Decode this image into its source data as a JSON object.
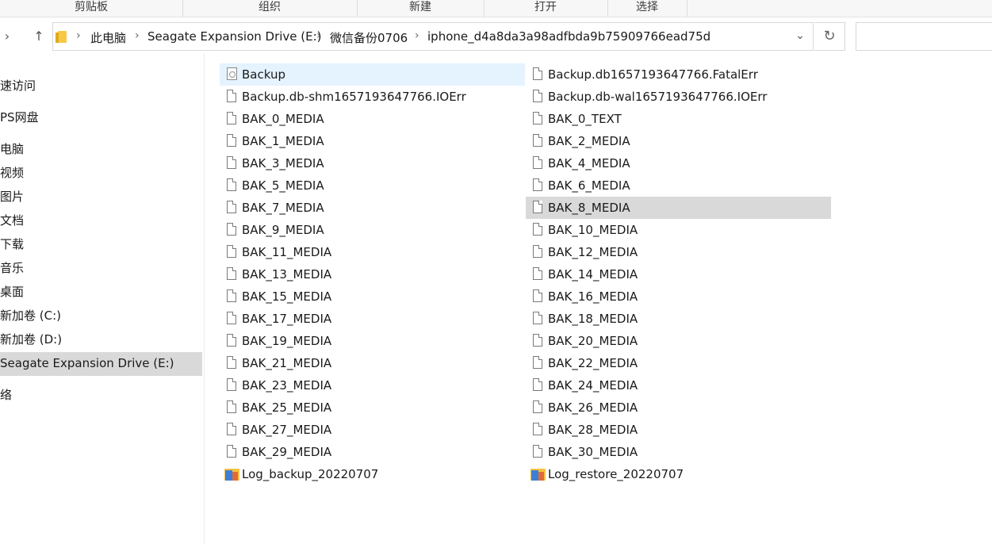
{
  "ribbon": {
    "groups": [
      "剪贴板",
      "组织",
      "新建",
      "打开",
      "选择"
    ]
  },
  "navbar": {
    "back_icon": "chevron-right-icon",
    "up_icon": "arrow-up-icon",
    "breadcrumbs": [
      "此电脑",
      "Seagate Expansion Drive (E:)",
      "微信备份0706",
      "iphone_d4a8da3a98adfbda9b75909766ead75d"
    ],
    "refresh_icon": "refresh-icon",
    "search_placeholder": ""
  },
  "sidebar": {
    "items": [
      "速访问",
      "PS网盘",
      "电脑",
      "视频",
      "图片",
      "文档",
      "下载",
      "音乐",
      "桌面",
      "新加卷 (C:)",
      "新加卷 (D:)",
      "Seagate Expansion Drive (E:)",
      "络"
    ],
    "selected_index": 11
  },
  "files": {
    "left": [
      {
        "name": "Backup",
        "icon": "database-file-icon"
      },
      {
        "name": "Backup.db-shm1657193647766.IOErr",
        "icon": "file-icon"
      },
      {
        "name": "BAK_0_MEDIA",
        "icon": "file-icon"
      },
      {
        "name": "BAK_1_MEDIA",
        "icon": "file-icon"
      },
      {
        "name": "BAK_3_MEDIA",
        "icon": "file-icon"
      },
      {
        "name": "BAK_5_MEDIA",
        "icon": "file-icon"
      },
      {
        "name": "BAK_7_MEDIA",
        "icon": "file-icon"
      },
      {
        "name": "BAK_9_MEDIA",
        "icon": "file-icon"
      },
      {
        "name": "BAK_11_MEDIA",
        "icon": "file-icon"
      },
      {
        "name": "BAK_13_MEDIA",
        "icon": "file-icon"
      },
      {
        "name": "BAK_15_MEDIA",
        "icon": "file-icon"
      },
      {
        "name": "BAK_17_MEDIA",
        "icon": "file-icon"
      },
      {
        "name": "BAK_19_MEDIA",
        "icon": "file-icon"
      },
      {
        "name": "BAK_21_MEDIA",
        "icon": "file-icon"
      },
      {
        "name": "BAK_23_MEDIA",
        "icon": "file-icon"
      },
      {
        "name": "BAK_25_MEDIA",
        "icon": "file-icon"
      },
      {
        "name": "BAK_27_MEDIA",
        "icon": "file-icon"
      },
      {
        "name": "BAK_29_MEDIA",
        "icon": "file-icon"
      },
      {
        "name": "Log_backup_20220707",
        "icon": "archive-folder-icon"
      }
    ],
    "right": [
      {
        "name": "Backup.db1657193647766.FatalErr",
        "icon": "file-icon"
      },
      {
        "name": "Backup.db-wal1657193647766.IOErr",
        "icon": "file-icon"
      },
      {
        "name": "BAK_0_TEXT",
        "icon": "file-icon"
      },
      {
        "name": "BAK_2_MEDIA",
        "icon": "file-icon"
      },
      {
        "name": "BAK_4_MEDIA",
        "icon": "file-icon"
      },
      {
        "name": "BAK_6_MEDIA",
        "icon": "file-icon"
      },
      {
        "name": "BAK_8_MEDIA",
        "icon": "file-icon"
      },
      {
        "name": "BAK_10_MEDIA",
        "icon": "file-icon"
      },
      {
        "name": "BAK_12_MEDIA",
        "icon": "file-icon"
      },
      {
        "name": "BAK_14_MEDIA",
        "icon": "file-icon"
      },
      {
        "name": "BAK_16_MEDIA",
        "icon": "file-icon"
      },
      {
        "name": "BAK_18_MEDIA",
        "icon": "file-icon"
      },
      {
        "name": "BAK_20_MEDIA",
        "icon": "file-icon"
      },
      {
        "name": "BAK_22_MEDIA",
        "icon": "file-icon"
      },
      {
        "name": "BAK_24_MEDIA",
        "icon": "file-icon"
      },
      {
        "name": "BAK_26_MEDIA",
        "icon": "file-icon"
      },
      {
        "name": "BAK_28_MEDIA",
        "icon": "file-icon"
      },
      {
        "name": "BAK_30_MEDIA",
        "icon": "file-icon"
      },
      {
        "name": "Log_restore_20220707",
        "icon": "archive-folder-icon"
      }
    ],
    "selected": "Backup",
    "hovered": "BAK_8_MEDIA"
  },
  "colors": {
    "selected_bg": "#e5f3ff",
    "hover_bg": "#d9d9d9",
    "sidebar_selected_bg": "#d9d9d9"
  }
}
